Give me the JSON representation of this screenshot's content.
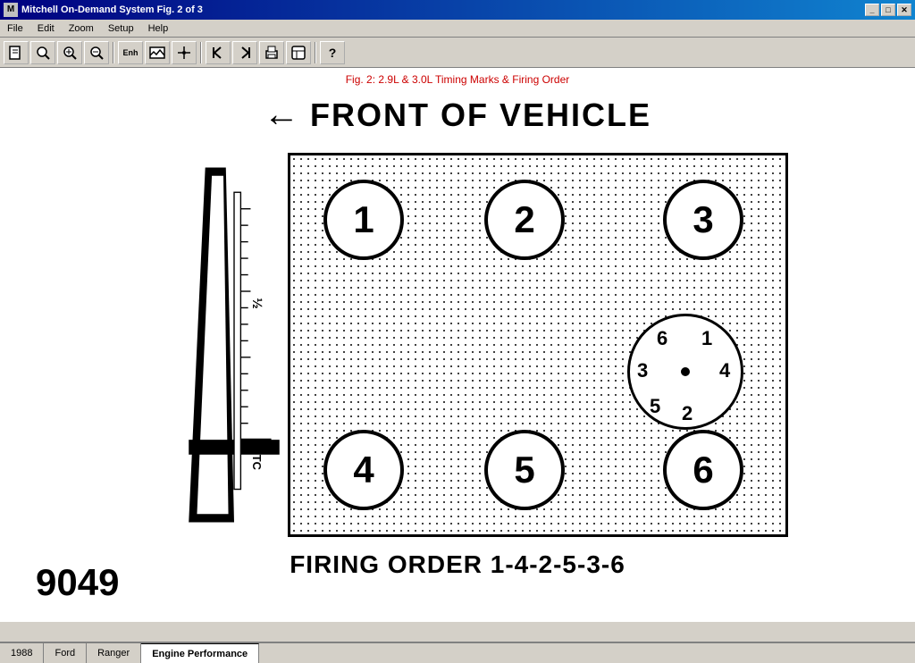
{
  "window": {
    "title": "Mitchell On-Demand System Fig. 2 of 3",
    "icon": "M"
  },
  "titlebar_buttons": [
    "_",
    "□",
    "✕"
  ],
  "menubar": {
    "items": [
      "File",
      "Edit",
      "Zoom",
      "Setup",
      "Help"
    ]
  },
  "toolbar": {
    "buttons": [
      "📄",
      "🔍",
      "⊕",
      "⊗",
      "Enh",
      "🖼",
      "✋",
      "◀",
      "▶",
      "🖨",
      "⚙",
      "?"
    ]
  },
  "figure": {
    "title": "Fig. 2:  2.9L & 3.0L Timing Marks & Firing Order",
    "front_label": "FRONT OF VEHICLE",
    "cylinders": [
      {
        "id": "1",
        "label": "1",
        "row": "top",
        "col": "left"
      },
      {
        "id": "2",
        "label": "2",
        "row": "top",
        "col": "center"
      },
      {
        "id": "3",
        "label": "3",
        "row": "top",
        "col": "right"
      },
      {
        "id": "4",
        "label": "4",
        "row": "bottom",
        "col": "left"
      },
      {
        "id": "5",
        "label": "5",
        "row": "bottom",
        "col": "center"
      },
      {
        "id": "6",
        "label": "6",
        "row": "bottom",
        "col": "right"
      }
    ],
    "distributor": {
      "numbers": [
        "6",
        "1",
        "3",
        "4",
        "5",
        "2"
      ],
      "positions": [
        "top-left",
        "top-right",
        "left",
        "right",
        "bottom-left",
        "bottom-right"
      ]
    },
    "firing_order": "FIRING ORDER 1-4-2-5-3-6",
    "fig_number": "9049",
    "timing_label": "½",
    "timing_tc": "TC"
  },
  "statusbar": {
    "tabs": [
      "1988",
      "Ford",
      "Ranger",
      "Engine Performance"
    ]
  }
}
